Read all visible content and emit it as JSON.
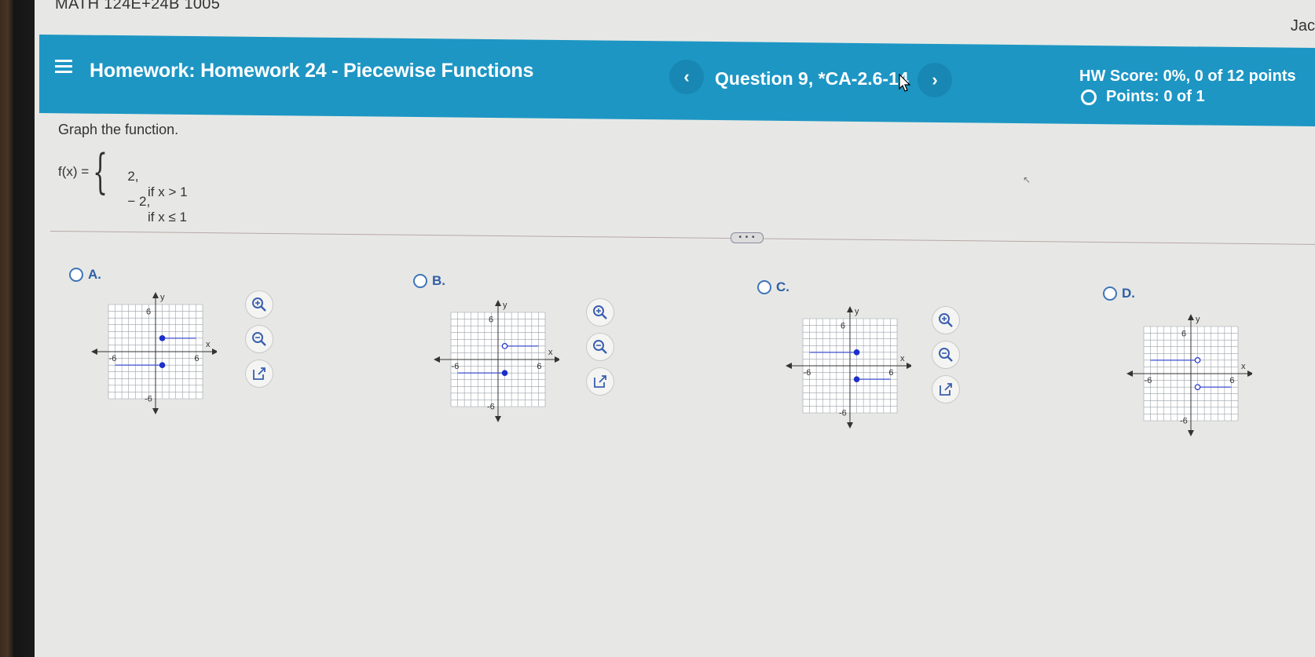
{
  "course": "MATH 124E+24B 1005",
  "user": "Jack",
  "header": {
    "homework_title": "Homework: Homework 24 - Piecewise Functions",
    "question": "Question 9, *CA-2.6-14",
    "prev": "‹",
    "next": "›",
    "hw_score": "HW Score: 0%, 0 of 12 points",
    "points": "Points: 0 of 1"
  },
  "problem": {
    "prompt": "Graph the function.",
    "lhs": "f(x) =",
    "cases": [
      {
        "value": "2,",
        "condition": "if x > 1"
      },
      {
        "value": "− 2,",
        "condition": "if x ≤ 1"
      }
    ]
  },
  "options": [
    {
      "letter": "A.",
      "axis_x": "x",
      "axis_y": "y",
      "tick_pos": "6",
      "tick_neg": "-6",
      "segments": [
        {
          "y": 2,
          "from": 1,
          "to": 6,
          "endpoint": "closed"
        },
        {
          "y": -2,
          "from": -6,
          "to": 1,
          "endpoint": "closed"
        }
      ]
    },
    {
      "letter": "B.",
      "axis_x": "x",
      "axis_y": "y",
      "tick_pos": "6",
      "tick_neg": "-6",
      "segments": [
        {
          "y": 2,
          "from": 1,
          "to": 6,
          "endpoint": "open"
        },
        {
          "y": -2,
          "from": -6,
          "to": 1,
          "endpoint": "closed"
        }
      ]
    },
    {
      "letter": "C.",
      "axis_x": "x",
      "axis_y": "y",
      "tick_pos": "6",
      "tick_neg": "-6",
      "segments": [
        {
          "y": 2,
          "from": -6,
          "to": 1,
          "endpoint": "closed"
        },
        {
          "y": -2,
          "from": 1,
          "to": 6,
          "endpoint": "closed"
        }
      ]
    },
    {
      "letter": "D.",
      "axis_x": "x",
      "axis_y": "y",
      "tick_pos": "6",
      "tick_neg": "-6",
      "segments": [
        {
          "y": 2,
          "from": -6,
          "to": 1,
          "endpoint": "open"
        },
        {
          "y": -2,
          "from": 1,
          "to": 6,
          "endpoint": "open"
        }
      ]
    }
  ],
  "colors": {
    "header": "#1d96c4",
    "graph_line": "#3b4fd0",
    "point": "#1d2fc9",
    "radio": "#3f74b8"
  },
  "icons": [
    "menu-icon",
    "zoom-in-icon",
    "zoom-out-icon",
    "external-link-icon"
  ]
}
